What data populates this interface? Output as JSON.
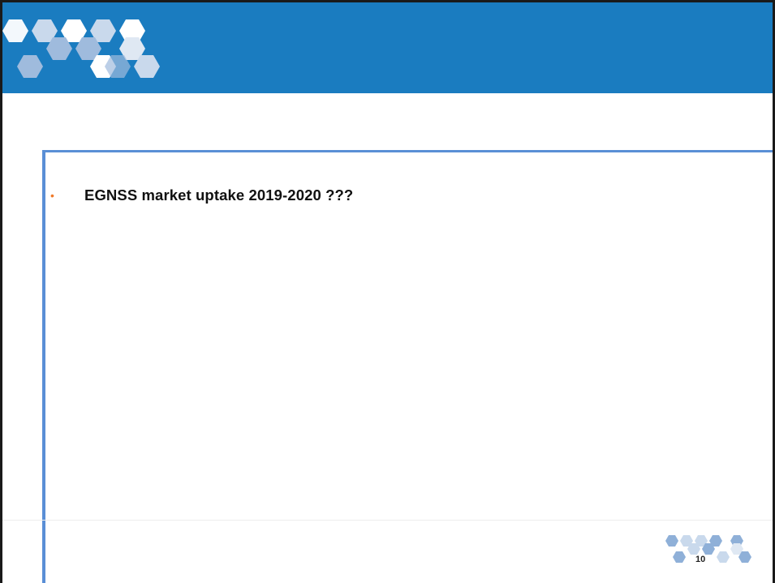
{
  "slide": {
    "bullets": [
      {
        "text": "EGNSS market uptake 2019-2020 ???"
      }
    ],
    "page_number": "10"
  },
  "colors": {
    "header_band": "#1a7cc0",
    "frame_accent": "#5a8fd6",
    "bullet": "#f07a2a"
  },
  "icons": {
    "header_logo": "hexagon-cluster-icon",
    "footer_logo": "hexagon-cluster-icon"
  }
}
